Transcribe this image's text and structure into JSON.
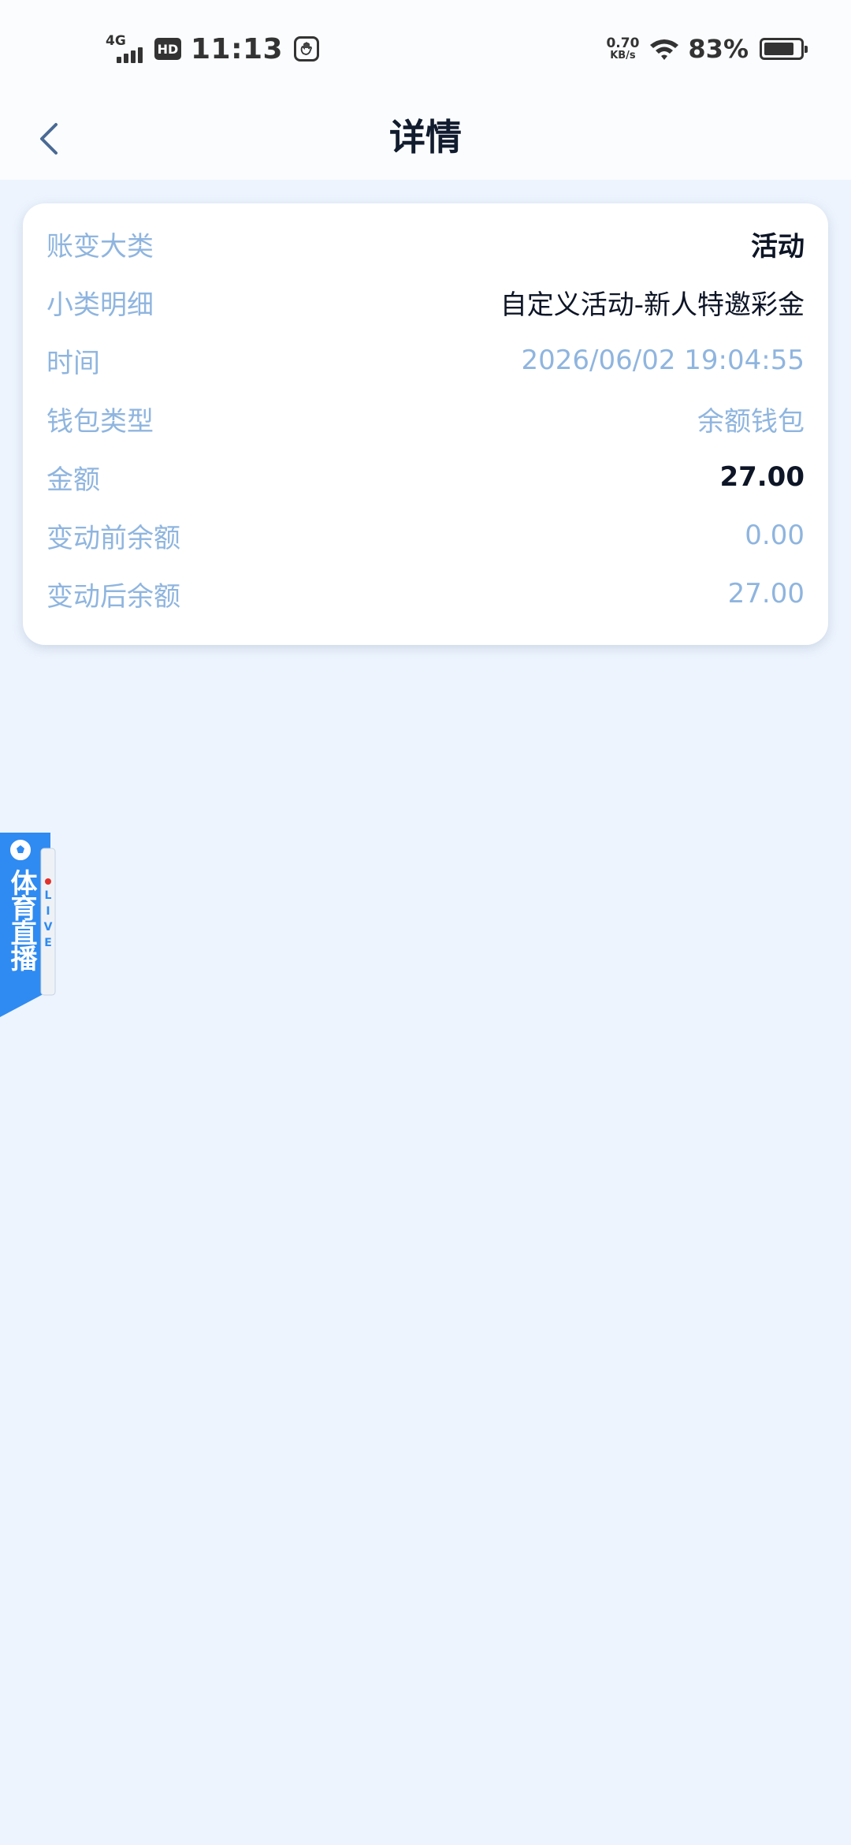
{
  "status_bar": {
    "network": "4G",
    "hd": "HD",
    "time": "11:13",
    "speed_value": "0.70",
    "speed_unit": "KB/s",
    "battery": "83%",
    "battery_level": 0.83
  },
  "nav": {
    "title": "详情"
  },
  "detail": {
    "rows": [
      {
        "label": "账变大类",
        "value": "活动"
      },
      {
        "label": "小类明细",
        "value": "自定义活动-新人特邀彩金"
      },
      {
        "label": "时间",
        "value": "2026/06/02 19:04:55"
      },
      {
        "label": "钱包类型",
        "value": "余额钱包"
      },
      {
        "label": "金额",
        "value": "27.00"
      },
      {
        "label": "变动前余额",
        "value": "0.00"
      },
      {
        "label": "变动后余额",
        "value": "27.00"
      }
    ]
  },
  "float_widget": {
    "title": "体育直播",
    "badge": "LIVE"
  },
  "colors": {
    "background": "#edf4fe",
    "label": "#8fb5df",
    "accent_blue": "#2f8bf1",
    "text_dark": "#0d1526"
  }
}
